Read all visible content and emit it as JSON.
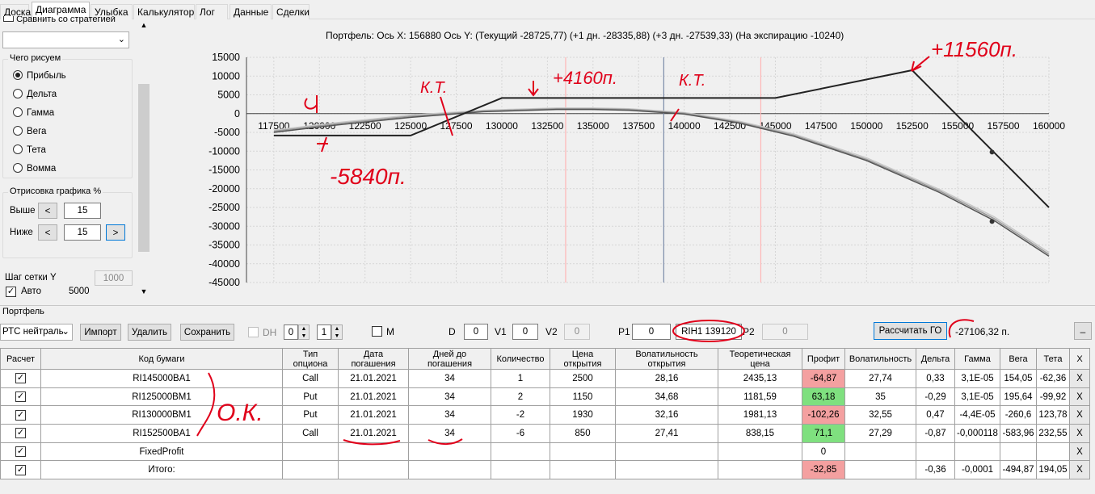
{
  "tabs": [
    "Доска",
    "Диаграмма",
    "Улыбка",
    "Калькулятор",
    "Лог",
    "Данные",
    "Сделки"
  ],
  "active_tab": "Диаграмма",
  "left_panel": {
    "compare_label": "Сравнить со стратегией",
    "draw_group_title": "Чего рисуем",
    "radio_options": [
      "Прибыль",
      "Дельта",
      "Гамма",
      "Вега",
      "Тета",
      "Вомма"
    ],
    "selected_radio": "Прибыль",
    "render_group_title": "Отрисовка графика %",
    "above_label": "Выше",
    "above_value": "15",
    "below_label": "Ниже",
    "below_value": "15",
    "prev_glyph": "<",
    "next_glyph": ">",
    "grid_step_label": "Шаг сетки Y",
    "grid_step_value": "1000",
    "auto_label": "Авто",
    "auto_value": "5000"
  },
  "chart_title": "Портфель: Ось X:  156880 Ось Y:  (Текущий -28725,77)  (+1 дн. -28335,88)  (+3 дн. -27539,33)  (На экспирацию -10240)",
  "chart_data": {
    "type": "line",
    "x_ticks": [
      117500,
      120000,
      122500,
      125000,
      127500,
      130000,
      132500,
      135000,
      137500,
      140000,
      142500,
      145000,
      147500,
      150000,
      152500,
      155000,
      157500,
      160000
    ],
    "y_ticks": [
      15000,
      10000,
      5000,
      0,
      -5000,
      -10000,
      -15000,
      -20000,
      -25000,
      -30000,
      -35000,
      -40000,
      -45000
    ],
    "xlim": [
      116000,
      160000
    ],
    "ylim": [
      -45000,
      15000
    ],
    "vertical_lines": [
      {
        "x": 133500,
        "color": "#ffb6b6"
      },
      {
        "x": 138880,
        "color": "#7a8aa8"
      },
      {
        "x": 144200,
        "color": "#ffb6b6"
      }
    ],
    "series": [
      {
        "values_x": [
          117500,
          125000,
          130000,
          145000,
          152500,
          160000
        ],
        "values_y": [
          -5840,
          -5840,
          4160,
          4160,
          11560,
          -25000
        ],
        "color": "#222222",
        "width": 2
      },
      {
        "values_x": [
          117500,
          121000,
          125000,
          129000,
          133000,
          135000,
          137000,
          140000,
          143000,
          146000,
          150000,
          154000,
          157000,
          160000
        ],
        "values_y": [
          -5000,
          -3000,
          -1000,
          500,
          1100,
          1100,
          900,
          -100,
          -2500,
          -6000,
          -12500,
          -21000,
          -28500,
          -38000
        ],
        "color": "#555555",
        "width": 1.5
      },
      {
        "values_x": [
          117500,
          121000,
          125000,
          129000,
          133000,
          135000,
          137000,
          140000,
          143000,
          146000,
          150000,
          154000,
          157000,
          160000
        ],
        "values_y": [
          -4700,
          -2700,
          -700,
          700,
          1300,
          1300,
          1100,
          100,
          -2300,
          -5700,
          -12200,
          -20600,
          -28000,
          -37500
        ],
        "color": "#999999",
        "width": 1.5
      },
      {
        "values_x": [
          117500,
          121000,
          125000,
          129000,
          133000,
          135000,
          137000,
          140000,
          143000,
          146000,
          150000,
          154000,
          157000,
          160000
        ],
        "values_y": [
          -4400,
          -2400,
          -400,
          900,
          1500,
          1500,
          1300,
          300,
          -2000,
          -5400,
          -11800,
          -20200,
          -27500,
          -37000
        ],
        "color": "#c8c8c8",
        "width": 1.5
      }
    ],
    "markers": [
      {
        "x": 156880,
        "y": -10240
      },
      {
        "x": 156880,
        "y": -28725.77
      }
    ],
    "annotations": [
      "+11560п.",
      "+4160п.",
      "К.Т.",
      "К.Т.",
      "-5840п."
    ]
  },
  "portfolio": {
    "section_label": "Портфель",
    "strategy_select": "РТС нейтраль",
    "import_btn": "Импорт",
    "delete_btn": "Удалить",
    "save_btn": "Сохранить",
    "dh_label": "DH",
    "dh_value1": "0",
    "dh_value2": "1",
    "m_label": "M",
    "d_label": "D",
    "d_value": "0",
    "v1_label": "V1",
    "v1_value": "0",
    "v2_label": "V2",
    "v2_value": "0",
    "p1_label": "P1",
    "p1_value": "0",
    "ticker_value": "RIH1 139120",
    "p2_label": "P2",
    "p2_value": "0",
    "calc_btn": "Рассчитать ГО",
    "go_value": "-27106,32 п.",
    "minimize_btn": "_"
  },
  "table": {
    "headers": [
      "Расчет",
      "Код бумаги",
      "Тип опциона",
      "Дата погашения",
      "Дней до погашения",
      "Количество",
      "Цена открытия",
      "Волатильность открытия",
      "Теоретическая цена",
      "Профит",
      "Волатильность",
      "Дельта",
      "Гамма",
      "Вега",
      "Тета",
      "X"
    ],
    "rows": [
      {
        "code": "RI145000BA1",
        "type": "Call",
        "date": "21.01.2021",
        "days": "34",
        "qty": "1",
        "price": "2500",
        "vol_open": "28,16",
        "theor": "2435,13",
        "profit": "-64,87",
        "vol": "27,74",
        "delta": "0,33",
        "gamma": "3,1E-05",
        "vega": "154,05",
        "theta": "-62,36",
        "x": "X"
      },
      {
        "code": "RI125000BM1",
        "type": "Put",
        "date": "21.01.2021",
        "days": "34",
        "qty": "2",
        "price": "1150",
        "vol_open": "34,68",
        "theor": "1181,59",
        "profit": "63,18",
        "vol": "35",
        "delta": "-0,29",
        "gamma": "3,1E-05",
        "vega": "195,64",
        "theta": "-99,92",
        "x": "X"
      },
      {
        "code": "RI130000BM1",
        "type": "Put",
        "date": "21.01.2021",
        "days": "34",
        "qty": "-2",
        "price": "1930",
        "vol_open": "32,16",
        "theor": "1981,13",
        "profit": "-102,26",
        "vol": "32,55",
        "delta": "0,47",
        "gamma": "-4,4E-05",
        "vega": "-260,6",
        "theta": "123,78",
        "x": "X"
      },
      {
        "code": "RI152500BA1",
        "type": "Call",
        "date": "21.01.2021",
        "days": "34",
        "qty": "-6",
        "price": "850",
        "vol_open": "27,41",
        "theor": "838,15",
        "profit": "71,1",
        "vol": "27,29",
        "delta": "-0,87",
        "gamma": "-0,000118",
        "vega": "-583,96",
        "theta": "232,55",
        "x": "X"
      }
    ],
    "fixed_label": "FixedProfit",
    "fixed_profit": "0",
    "total_label": "Итого:",
    "total_profit": "-32,85",
    "total_delta": "-0,36",
    "total_gamma": "-0,0001",
    "total_vega": "-494,87",
    "total_theta": "194,05",
    "x_label": "X"
  },
  "handwritten": {
    "ok": "О.К."
  }
}
